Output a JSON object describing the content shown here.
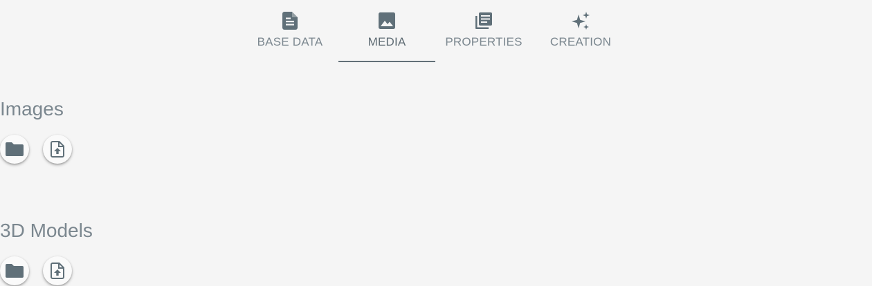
{
  "tabs": [
    {
      "label": "BASE DATA",
      "icon": "document-icon",
      "active": false
    },
    {
      "label": "MEDIA",
      "icon": "image-icon",
      "active": true
    },
    {
      "label": "PROPERTIES",
      "icon": "library-books-icon",
      "active": false
    },
    {
      "label": "CREATION",
      "icon": "sparkle-icon",
      "active": false
    }
  ],
  "sections": {
    "images": {
      "title": "Images",
      "buttons": [
        "folder-icon",
        "file-upload-icon"
      ]
    },
    "models": {
      "title": "3D Models",
      "buttons": [
        "folder-icon",
        "file-upload-icon"
      ]
    }
  },
  "colors": {
    "background": "#f5f5f5",
    "icon": "#607079",
    "text": "#7b878f",
    "active_indicator": "#627078"
  }
}
